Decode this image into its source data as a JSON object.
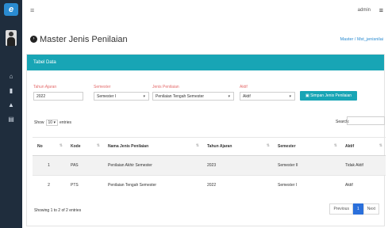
{
  "topbar": {
    "menu_glyph": "≡",
    "user": "admin",
    "right_glyph": "≡"
  },
  "page": {
    "title": "Master Jenis Penilaian",
    "breadcrumb": "Master / Mst_jenisnilai"
  },
  "card": {
    "title": "Tabel Data"
  },
  "form": {
    "tahun_label": "Tahun Ajaran",
    "tahun_value": "2022",
    "semester_label": "Semester",
    "semester_value": "Semester I",
    "jenis_label": "Jenis Penilaian",
    "jenis_value": "Penilaian Tengah Semester",
    "aktif_label": "Aktif",
    "aktif_value": "Aktif",
    "save_label": "Simpan Jenis Penilaian"
  },
  "table_controls": {
    "show": "Show",
    "entries_value": "10",
    "entries": "entries",
    "search": "Search:"
  },
  "table": {
    "headers": [
      "No",
      "Kode",
      "Nama Jenis Penilaian",
      "Tahun Ajaran",
      "Semester",
      "Aktif"
    ],
    "rows": [
      [
        "1",
        "PAS",
        "Penilaian Akhir Semester",
        "2023",
        "Semester II",
        "Tidak Aktif"
      ],
      [
        "2",
        "PTS",
        "Penilaian Tengah Semester",
        "2022",
        "Semester I",
        "Aktif"
      ]
    ]
  },
  "footer": {
    "showing": "Showing 1 to 2 of 2 entries",
    "prev": "Previous",
    "page": "1",
    "next": "Next"
  },
  "colors": {
    "accent": "#18a5b5",
    "sidebar": "#1f2d3d",
    "pager_active": "#2a6fdb"
  }
}
